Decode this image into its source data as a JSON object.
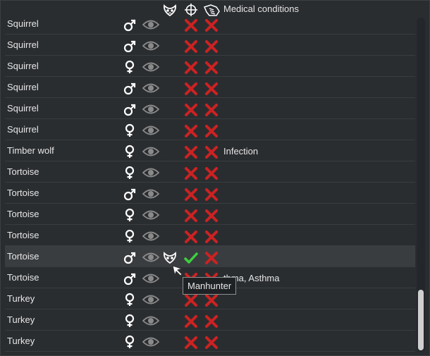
{
  "header": {
    "icons": [
      "manhunter-icon",
      "hunt-crosshair-icon",
      "tame-hand-icon"
    ],
    "label": "Medical conditions"
  },
  "rows": [
    {
      "name": "Squirrel",
      "gender": "male",
      "condition": "",
      "selected": false
    },
    {
      "name": "Squirrel",
      "gender": "male",
      "condition": "",
      "selected": false
    },
    {
      "name": "Squirrel",
      "gender": "female",
      "condition": "",
      "selected": false
    },
    {
      "name": "Squirrel",
      "gender": "male",
      "condition": "",
      "selected": false
    },
    {
      "name": "Squirrel",
      "gender": "male",
      "condition": "",
      "selected": false
    },
    {
      "name": "Squirrel",
      "gender": "female",
      "condition": "",
      "selected": false
    },
    {
      "name": "Timber wolf",
      "gender": "female",
      "condition": "Infection",
      "selected": false
    },
    {
      "name": "Tortoise",
      "gender": "female",
      "condition": "",
      "selected": false
    },
    {
      "name": "Tortoise",
      "gender": "male",
      "condition": "",
      "selected": false
    },
    {
      "name": "Tortoise",
      "gender": "female",
      "condition": "",
      "selected": false
    },
    {
      "name": "Tortoise",
      "gender": "female",
      "condition": "",
      "selected": false
    },
    {
      "name": "Tortoise",
      "gender": "male",
      "condition": "",
      "selected": true,
      "manhunter": true,
      "hunt": true
    },
    {
      "name": "Tortoise",
      "gender": "male",
      "condition": "thma, Asthma",
      "selected": false
    },
    {
      "name": "Turkey",
      "gender": "female",
      "condition": "",
      "selected": false
    },
    {
      "name": "Turkey",
      "gender": "female",
      "condition": "",
      "selected": false
    },
    {
      "name": "Turkey",
      "gender": "female",
      "condition": "",
      "selected": false
    }
  ],
  "tooltip": {
    "text": "Manhunter"
  },
  "colors": {
    "cross": "#cc2222",
    "check": "#3ecf3e",
    "icon": "#ffffff",
    "eye": "#8a8a8a"
  }
}
